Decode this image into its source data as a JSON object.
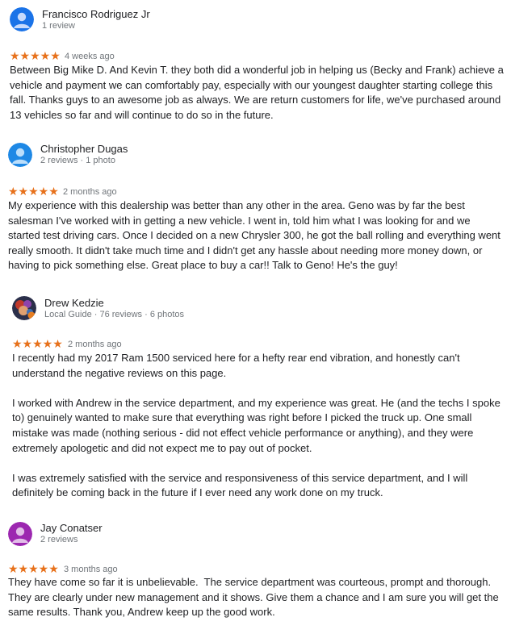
{
  "reviews": [
    {
      "name": "Francisco Rodriguez Jr",
      "meta": "1 review",
      "stars": "★★★★★",
      "time": "4 weeks ago",
      "text": "Between Big Mike D. And Kevin T. they both did a wonderful job in helping us (Becky and Frank) achieve a\nvehicle and payment we can comfortably pay, especially with our youngest daughter starting college this\nfall. Thanks guys to an awesome job as always. We are return customers for life, we've purchased around\n13 vehicles so far and will continue to do so in the future.",
      "avatar_color": "#1a73e8"
    },
    {
      "name": "Christopher Dugas",
      "meta": "2 reviews · 1 photo",
      "stars": "★★★★★",
      "time": "2 months ago",
      "text": "My experience with this dealership was better than any other in the area. Geno was by far the best\nsalesman I've worked with in getting a new vehicle. I went in, told him what I was looking for and we\nstarted test driving cars. Once I decided on a new Chrysler 300, he got the ball rolling and everything went\nreally smooth. It didn't take much time and I didn't get any hassle about needing more money down, or\nhaving to pick something else. Great place to buy a car!! Talk to Geno! He's the guy!",
      "avatar_color": "#1e88e5"
    },
    {
      "name": "Drew Kedzie",
      "meta": "Local Guide · 76 reviews · 6 photos",
      "stars": "★★★★★",
      "time": "2 months ago",
      "text": "I recently had my 2017 Ram 1500 serviced here for a hefty rear end vibration, and honestly can't\nunderstand the negative reviews on this page.\n\nI worked with Andrew in the service department, and my experience was great. He (and the techs I spoke\nto) genuinely wanted to make sure that everything was right before I picked the truck up. One small\nmistake was made (nothing serious - did not effect vehicle performance or anything), and they were\nextremely apologetic and did not expect me to pay out of pocket.\n\nI was extremely satisfied with the service and responsiveness of this service department, and I will\ndefinitely be coming back in the future if I ever need any work done on my truck.",
      "avatar_color": "#7b4b9e"
    },
    {
      "name": "Jay Conatser",
      "meta": "2 reviews",
      "stars": "★★★★★",
      "time": "3 months ago",
      "text": "They have come so far it is unbelievable.  The service department was courteous, prompt and thorough.\nThey are clearly under new management and it shows. Give them a chance and I am sure you will get the\nsame results. Thank you, Andrew keep up the good work.",
      "avatar_color": "#9c27b0"
    }
  ],
  "colors": {
    "star": "#e7711b",
    "meta_text": "#70757a",
    "body_text": "#202124"
  }
}
